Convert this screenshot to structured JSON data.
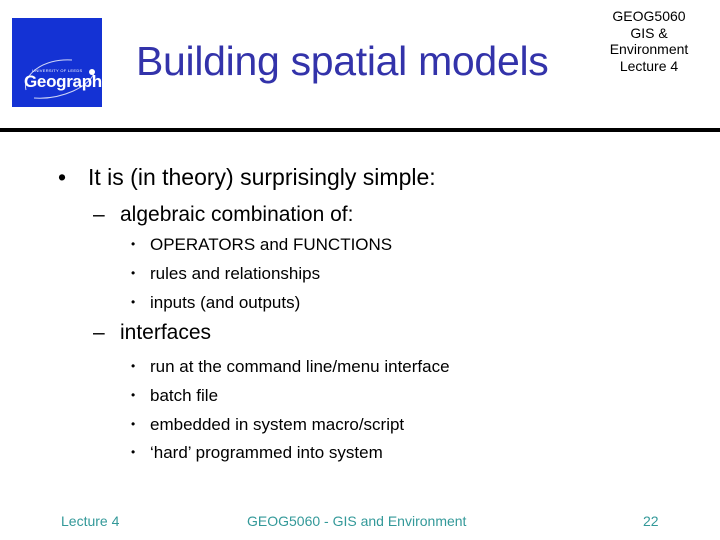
{
  "logo": {
    "small_text": "UNIVERSITY OF LEEDS",
    "word": "Geography",
    "bg_color": "#1432d4"
  },
  "header": {
    "title": "Building spatial models",
    "title_color": "#3333aa",
    "course_lines": [
      "GEOG5060",
      "GIS &",
      "Environment",
      "Lecture 4"
    ]
  },
  "content": {
    "bullet": "•",
    "dash": "–",
    "sub_bullet": "•",
    "main_point": "It is (in theory) surprisingly simple:",
    "groups": [
      {
        "label": "algebraic combination of:",
        "items": [
          "OPERATORS and FUNCTIONS",
          "rules and relationships",
          "inputs (and outputs)"
        ]
      },
      {
        "label": "interfaces",
        "items": [
          "run at the command line/menu interface",
          "batch file",
          "embedded in system macro/script",
          "‘hard’ programmed into system"
        ]
      }
    ]
  },
  "footer": {
    "left": "Lecture 4",
    "center": "GEOG5060 - GIS and Environment",
    "page_number": "22",
    "color": "#339999"
  }
}
